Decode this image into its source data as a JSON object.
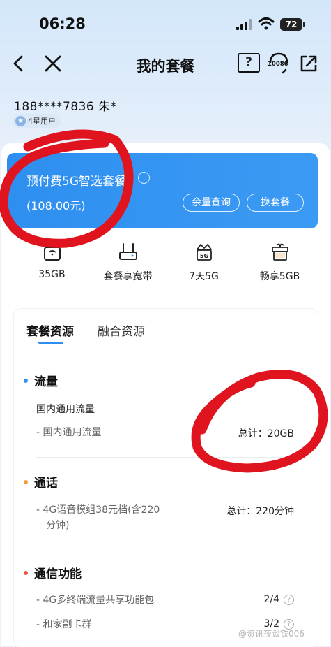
{
  "status_bar": {
    "time": "06:28",
    "battery": "72"
  },
  "nav": {
    "title": "我的套餐",
    "help": "?",
    "service_number": "10086"
  },
  "user": {
    "phone": "188****7836 朱*",
    "level": "4星用户"
  },
  "plan": {
    "name": "预付费5G智选套餐",
    "price": "(108.00元)",
    "btn_balance": "余量查询",
    "btn_change": "换套餐"
  },
  "benefits": [
    {
      "label": "35GB",
      "icon": "sim-bag-icon"
    },
    {
      "label": "套餐享宽带",
      "icon": "router-icon"
    },
    {
      "label": "7天5G",
      "icon": "crown-5g-icon"
    },
    {
      "label": "畅享5GB",
      "icon": "gift-icon"
    }
  ],
  "tabs": {
    "active": "套餐资源",
    "inactive": "融合资源"
  },
  "sections": {
    "data": {
      "title": "流量",
      "sub_title": "国内通用流量",
      "row_label": "- 国内通用流量",
      "row_value": "总计：20GB"
    },
    "voice": {
      "title": "通话",
      "row_label_1": "- 4G语音模组38元档(含220",
      "row_label_2": "  分钟)",
      "row_value": "总计：220分钟"
    },
    "features": {
      "title": "通信功能",
      "row1_label": "- 4G多终端流量共享功能包",
      "row1_value": "2/4",
      "row2_label": "- 和家副卡群",
      "row2_value": "3/2"
    }
  },
  "colors": {
    "accent": "#2e8ff0",
    "dot_blue": "#2e8ff0",
    "dot_orange": "#f29b38",
    "dot_red": "#e8543c",
    "scribble": "#e0141e"
  },
  "watermark": "@资讯夜谈铁006"
}
